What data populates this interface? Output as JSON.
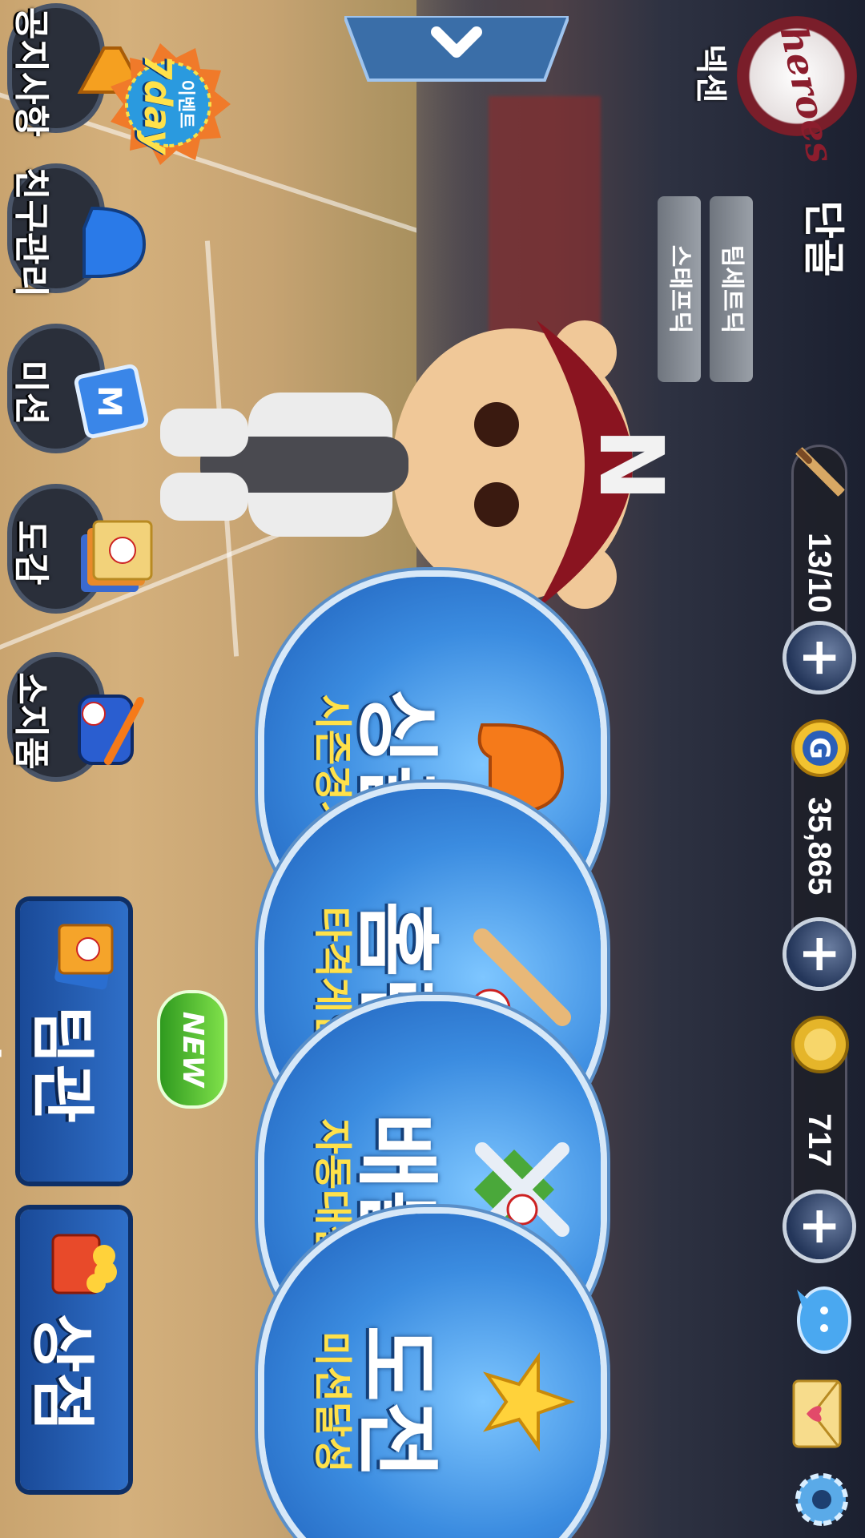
{
  "header": {
    "team_name": "넥센",
    "team_logo_text": "heroes",
    "player_name": "단골",
    "team_tab": "팀세트딕",
    "staff_tab": "스태프딕"
  },
  "resources": {
    "energy": "13/10",
    "gold": "35,865",
    "coins": "717"
  },
  "modes": [
    {
      "title": "싱글",
      "subtitle": "시즌경기"
    },
    {
      "title": "홈런",
      "subtitle": "타격게임"
    },
    {
      "title": "배틀",
      "subtitle": "자동대결"
    },
    {
      "title": "도전",
      "subtitle": "미션달성"
    }
  ],
  "menu": [
    {
      "label": "공지사항"
    },
    {
      "label": "친구관리"
    },
    {
      "label": "미션"
    },
    {
      "label": "도감"
    },
    {
      "label": "소지품"
    }
  ],
  "big_menu": [
    {
      "label": "팀관리",
      "badge": "NEW"
    },
    {
      "label": "상점"
    }
  ],
  "event_badge": {
    "top": "이벤트",
    "main": "7day"
  },
  "colors": {
    "accent": "#3b8ce0",
    "gold_text": "#ffe14a",
    "team_red": "#8b1d2d"
  }
}
